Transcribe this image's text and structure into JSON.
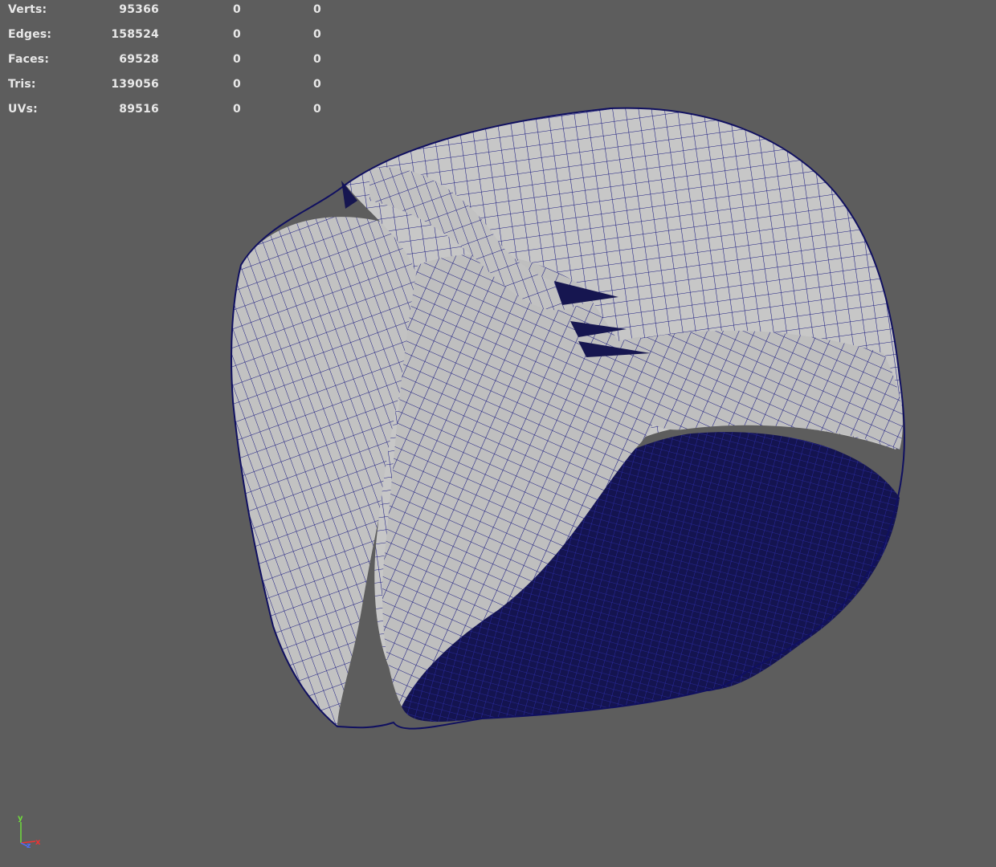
{
  "hud": {
    "rows": [
      {
        "label": "Verts:",
        "v1": "95366",
        "v2": "0",
        "v3": "0"
      },
      {
        "label": "Edges:",
        "v1": "158524",
        "v2": "0",
        "v3": "0"
      },
      {
        "label": "Faces:",
        "v1": "69528",
        "v2": "0",
        "v3": "0"
      },
      {
        "label": "Tris:",
        "v1": "139056",
        "v2": "0",
        "v3": "0"
      },
      {
        "label": "UVs:",
        "v1": "89516",
        "v2": "0",
        "v3": "0"
      }
    ]
  },
  "viewport": {
    "background": "#5d5d5d",
    "mesh_fill": "#c9c9c9",
    "wire_color": "#14147a",
    "underside_color": "#1a1a5a"
  },
  "axis_gizmo": {
    "y_label": "y",
    "x_label": "x",
    "z_label": "z",
    "y_color": "#6fdc3c",
    "x_color": "#ee3333",
    "z_color": "#4d6dff"
  }
}
